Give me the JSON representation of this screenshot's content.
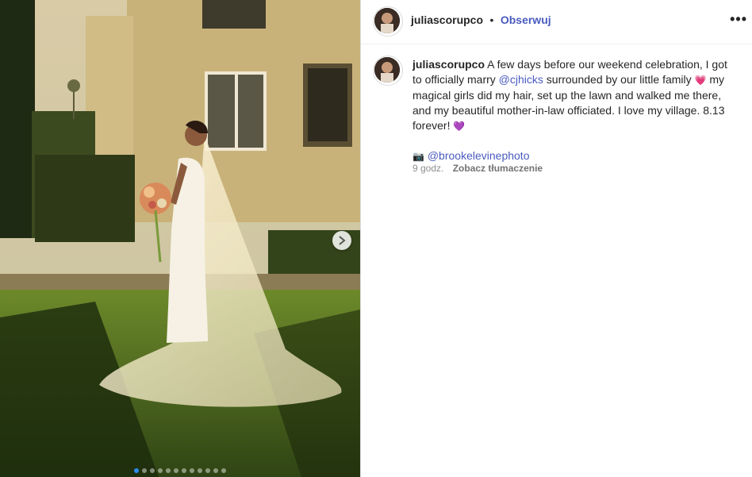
{
  "post": {
    "username": "juliascorupco",
    "separator": "•",
    "follow_label": "Obserwuj",
    "more_label": "•••"
  },
  "caption": {
    "username": "juliascorupco",
    "text_part1": " A few days before our weekend celebration, I got to officially marry ",
    "mention1": "@cjhicks",
    "text_part2": " surrounded by our little family ",
    "emoji1": "💗",
    "text_part3": " my magical girls did my hair, set up the lawn and walked me there, and my beautiful mother-in-law officiated. I love my village. 8.13 forever! ",
    "emoji2": "💜",
    "camera_emoji": "📷",
    "mention2": "@brookelevinephoto"
  },
  "meta": {
    "time": "9 godz.",
    "translate_label": "Zobacz tłumaczenie"
  },
  "carousel": {
    "total_slides": 12,
    "active_index": 0
  },
  "colors": {
    "accent": "#4a5bbf",
    "active_dot": "#2d8cf0"
  }
}
